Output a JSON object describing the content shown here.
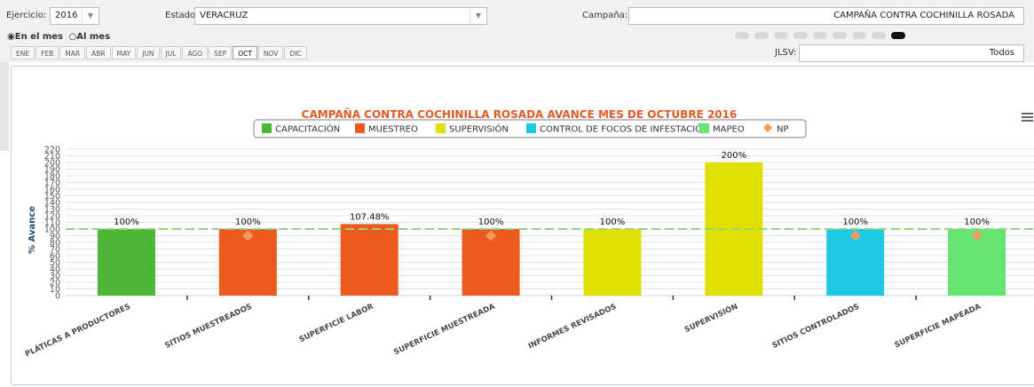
{
  "filters": {
    "ejercicio_label": "Ejercicio:",
    "ejercicio_value": "2016",
    "estado_label": "Estado:",
    "estado_value": "VERACRUZ",
    "campana_label": "Campaña:",
    "campana_value": "CAMPAÑA CONTRA COCHINILLA ROSADA",
    "jlsv_label": "JLSV:",
    "jlsv_value": "Todos"
  },
  "period": {
    "option_month": "En el mes",
    "option_cumulative": "Al mes",
    "selected": "En el mes"
  },
  "months": [
    "ENE",
    "FEB",
    "MAR",
    "ABR",
    "MAY",
    "JUN",
    "JUL",
    "AGO",
    "SEP",
    "OCT",
    "NOV",
    "DIC"
  ],
  "active_month": "OCT",
  "carousel": {
    "count": 9,
    "active_index": 8
  },
  "menu_icon": "hamburger-menu-icon",
  "chart_data": {
    "type": "bar",
    "title": "CAMPAÑA CONTRA COCHINILLA ROSADA AVANCE MES DE OCTUBRE 2016",
    "ylabel": "% Avance",
    "ylim": [
      0,
      220
    ],
    "yticks": [
      0,
      10,
      20,
      30,
      40,
      50,
      60,
      70,
      80,
      90,
      100,
      110,
      120,
      130,
      140,
      150,
      160,
      170,
      180,
      190,
      200,
      210,
      220
    ],
    "reference_line": 100,
    "legend_position": "top-center",
    "legend": [
      {
        "name": "CAPACITACIÓN",
        "color": "#4cb737",
        "shape": "square"
      },
      {
        "name": "MUESTREO",
        "color": "#ec5a1e",
        "shape": "square"
      },
      {
        "name": "SUPERVISIÓN",
        "color": "#dfe000",
        "shape": "square"
      },
      {
        "name": "CONTROL DE FOCOS DE INFESTACIÓN",
        "color": "#1fc8e3",
        "shape": "square"
      },
      {
        "name": "MAPEO",
        "color": "#67e373",
        "shape": "square"
      },
      {
        "name": "NP",
        "color": "#f49b5e",
        "shape": "diamond"
      }
    ],
    "categories": [
      "PLÁTICAS A PRODUCTORES",
      "SITIOS MUESTREADOS",
      "SUPERFICIE LABOR",
      "SUPERFICIE MUESTREADA",
      "INFORMES REVISADOS",
      "SUPERVISIÓN",
      "SITIOS CONTROLADOS",
      "SUPERFICIE MAPEADA"
    ],
    "values": [
      100,
      100,
      107.48,
      100,
      100,
      200,
      100,
      100
    ],
    "value_labels": [
      "100%",
      "100%",
      "107.48%",
      "100%",
      "100%",
      "200%",
      "100%",
      "100%"
    ],
    "bar_series": [
      "CAPACITACIÓN",
      "MUESTREO",
      "MUESTREO",
      "MUESTREO",
      "SUPERVISIÓN",
      "SUPERVISIÓN",
      "CONTROL DE FOCOS DE INFESTACIÓN",
      "MAPEO"
    ],
    "np_values": [
      null,
      90,
      null,
      90,
      null,
      null,
      90,
      90
    ]
  }
}
